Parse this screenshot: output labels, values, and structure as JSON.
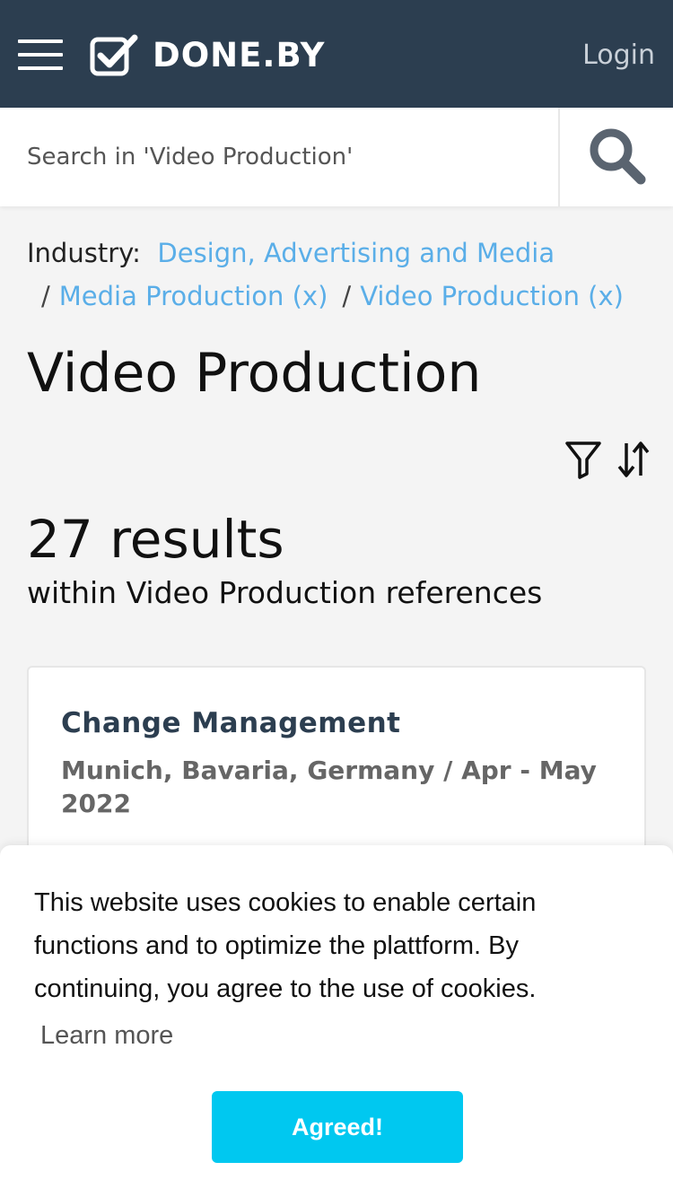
{
  "header": {
    "brand": "DONE.BY",
    "login_label": "Login"
  },
  "search": {
    "placeholder": "Search in 'Video Production'"
  },
  "breadcrumb": {
    "label": "Industry:",
    "items": [
      "Design, Advertising and Media",
      "Media Production (x)",
      "Video Production (x)"
    ],
    "separator": "/"
  },
  "page": {
    "title": "Video Production",
    "results_count": "27 results",
    "results_sub": "within Video Production references"
  },
  "cards": [
    {
      "title": "Change Management",
      "meta": "Munich, Bavaria, Germany / Apr - May 2022"
    }
  ],
  "cookie": {
    "text": "This website uses cookies to enable certain functions and to optimize the plattform. By continuing, you agree to the use of cookies.",
    "learn_more": "Learn more",
    "agree_label": "Agreed!"
  },
  "colors": {
    "header_bg": "#2c3e50",
    "link": "#5aaee8",
    "accent_button": "#00c8f0"
  },
  "icons": [
    "menu-icon",
    "logo-check-icon",
    "search-icon",
    "filter-icon",
    "sort-icon"
  ]
}
